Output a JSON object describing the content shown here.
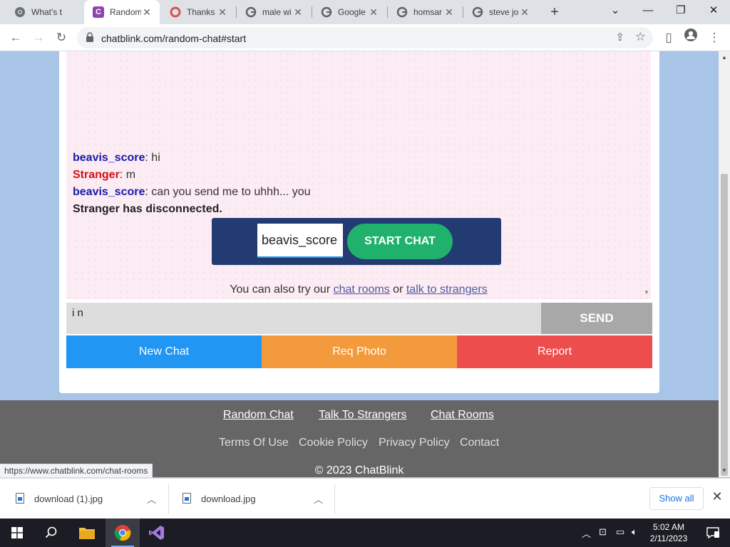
{
  "browser": {
    "tabs": [
      {
        "title": "What's t",
        "icon": "chrome-icon",
        "active": false
      },
      {
        "title": "Random",
        "icon": "chatblink-icon",
        "active": true
      },
      {
        "title": "Thanks",
        "icon": "site-icon",
        "active": false
      },
      {
        "title": "male wi",
        "icon": "google-icon",
        "active": false
      },
      {
        "title": "Google",
        "icon": "google-icon",
        "active": false
      },
      {
        "title": "homsar",
        "icon": "google-icon",
        "active": false
      },
      {
        "title": "steve jo",
        "icon": "google-icon",
        "active": false
      }
    ],
    "url": "chatblink.com/random-chat#start",
    "status_url": "https://www.chatblink.com/chat-rooms"
  },
  "chat": {
    "messages": [
      {
        "sender": "beavis_score",
        "role": "you",
        "text": ": hi"
      },
      {
        "sender": "Stranger",
        "role": "stranger",
        "text": ": m"
      },
      {
        "sender": "beavis_score",
        "role": "you",
        "text": ": can you send me to uhhh... you"
      }
    ],
    "system_message": "Stranger has disconnected.",
    "username_value": "beavis_score",
    "start_button": "START CHAT",
    "also_try_prefix": "You can also try our ",
    "also_try_link1": "chat rooms",
    "also_try_mid": " or ",
    "also_try_link2": "talk to strangers",
    "input_value": "i n",
    "send_button": "SEND",
    "actions": {
      "new_chat": "New Chat",
      "req_photo": "Req Photo",
      "report": "Report"
    },
    "colors": {
      "you": "#1a1aa8",
      "stranger": "#d41111",
      "new_chat": "#2196f3",
      "req_photo": "#f39a3c",
      "report": "#ee4d4d",
      "start": "#20b26c"
    }
  },
  "footer": {
    "links_row1": [
      "Random Chat",
      "Talk To Strangers",
      "Chat Rooms"
    ],
    "links_row2": [
      "Terms Of Use",
      "Cookie Policy",
      "Privacy Policy",
      "Contact"
    ],
    "copyright": "© 2023 ChatBlink"
  },
  "downloads": {
    "items": [
      "download (1).jpg",
      "download.jpg"
    ],
    "show_all": "Show all"
  },
  "taskbar": {
    "time": "5:02 AM",
    "date": "2/11/2023"
  }
}
